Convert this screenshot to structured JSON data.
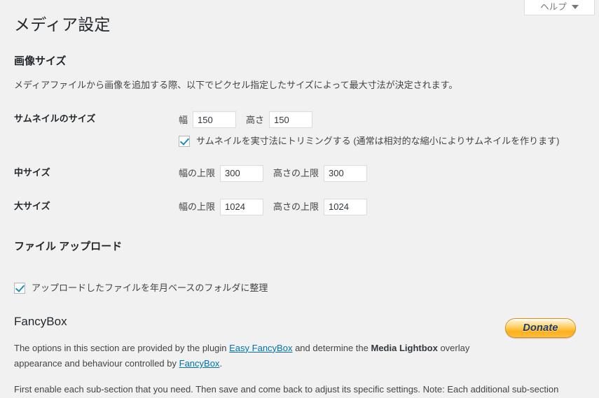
{
  "help": {
    "label": "ヘルプ",
    "icon": "chevron-down-icon"
  },
  "page": {
    "title": "メディア設定"
  },
  "image_sizes": {
    "heading": "画像サイズ",
    "description": "メディアファイルから画像を追加する際、以下でピクセル指定したサイズによって最大寸法が決定されます。",
    "thumbnail": {
      "label": "サムネイルのサイズ",
      "width_label": "幅",
      "width_value": "150",
      "height_label": "高さ",
      "height_value": "150",
      "crop_checked": true,
      "crop_label": "サムネイルを実寸法にトリミングする (通常は相対的な縮小によりサムネイルを作ります)"
    },
    "medium": {
      "label": "中サイズ",
      "width_label": "幅の上限",
      "width_value": "300",
      "height_label": "高さの上限",
      "height_value": "300"
    },
    "large": {
      "label": "大サイズ",
      "width_label": "幅の上限",
      "width_value": "1024",
      "height_label": "高さの上限",
      "height_value": "1024"
    }
  },
  "uploads": {
    "heading": "ファイル アップロード",
    "organize_checked": true,
    "organize_label": "アップロードしたファイルを年月ベースのフォルダに整理"
  },
  "fancybox": {
    "heading": "FancyBox",
    "para1_part1": "The options in this section are provided by the plugin ",
    "para1_link1": "Easy FancyBox",
    "para1_part2": " and determine the ",
    "para1_bold": "Media Lightbox",
    "para1_part3": " overlay appearance and behaviour controlled by ",
    "para1_link2": "FancyBox",
    "para1_part4": ".",
    "para2": "First enable each sub-section that you need. Then save and come back to adjust its specific settings. Note: Each additional sub-section",
    "donate_label": "Donate"
  },
  "colors": {
    "background": "#f1f1f1",
    "link": "#0073aa",
    "heading": "#23282d",
    "checkbox_check": "#1e8cbe",
    "donate_border": "#e08e11"
  }
}
